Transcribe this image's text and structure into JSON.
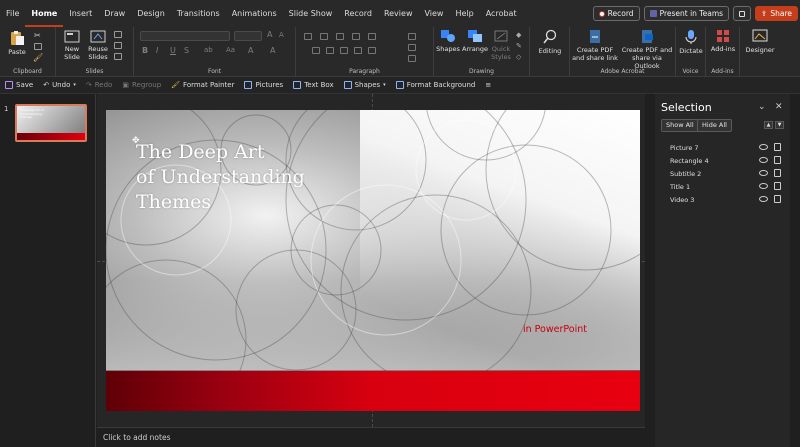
{
  "menu": {
    "tabs": [
      "File",
      "Home",
      "Insert",
      "Draw",
      "Design",
      "Transitions",
      "Animations",
      "Slide Show",
      "Record",
      "Review",
      "View",
      "Help",
      "Acrobat"
    ],
    "active": "Home",
    "record_label": "Record",
    "present_label": "Present in Teams",
    "share_label": "Share"
  },
  "ribbon": {
    "clipboard": {
      "paste": "Paste",
      "label": "Clipboard"
    },
    "slides": {
      "new_slide": "New Slide",
      "reuse_slides": "Reuse Slides",
      "label": "Slides"
    },
    "font": {
      "label": "Font",
      "bold": "B",
      "italic": "I",
      "underline": "U",
      "strike": "S"
    },
    "paragraph": {
      "label": "Paragraph"
    },
    "drawing": {
      "shapes": "Shapes",
      "arrange": "Arrange",
      "quick_styles": "Quick Styles",
      "label": "Drawing"
    },
    "editing": {
      "label_btn": "Editing"
    },
    "adobe": {
      "create_pdf_share": "Create PDF and share link",
      "create_pdf_outlook": "Create PDF and share via Outlook",
      "label": "Adobe Acrobat"
    },
    "voice": {
      "dictate": "Dictate",
      "label": "Voice"
    },
    "addins": {
      "addins": "Add-ins",
      "label": "Add-ins"
    },
    "designer": {
      "designer": "Designer"
    }
  },
  "qat": {
    "save": "Save",
    "undo": "Undo",
    "redo": "Redo",
    "regroup": "Regroup",
    "format_painter": "Format Painter",
    "pictures": "Pictures",
    "text_box": "Text Box",
    "shapes": "Shapes",
    "format_background": "Format Background"
  },
  "thumbnails": [
    {
      "number": "1",
      "title": "The Deep Art of Understanding Themes"
    }
  ],
  "slide": {
    "title_lines": [
      "The Deep Art",
      "of Understanding",
      "Themes"
    ],
    "subtitle_prefix": "in",
    "subtitle_main": "PowerPoint"
  },
  "notes_placeholder": "Click to add notes",
  "selection_pane": {
    "title": "Selection",
    "show_all": "Show All",
    "hide_all": "Hide All",
    "items": [
      "Picture 7",
      "Rectangle 4",
      "Subtitle 2",
      "Title 1",
      "Video 3"
    ]
  },
  "colors": {
    "accent": "#c43e1c",
    "slide_red": "#e8000f",
    "subtitle_red": "#c8000f"
  }
}
